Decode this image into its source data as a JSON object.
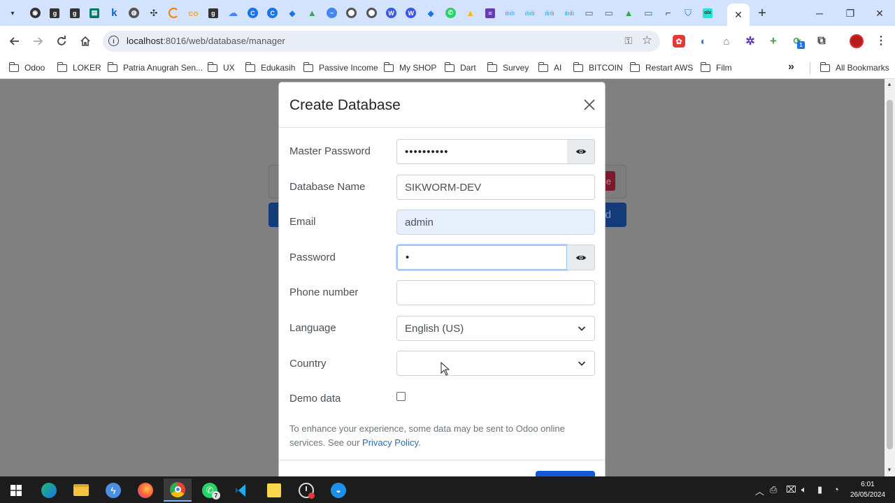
{
  "browser": {
    "url_host": "localhost",
    "url_rest": ":8016/web/database/manager",
    "active_tab_close": "✕",
    "new_tab": "+",
    "bookmarks": [
      {
        "label": "Odoo",
        "icon": "folder-icon"
      },
      {
        "label": "LOKER",
        "icon": "folder-icon"
      },
      {
        "label": "Patria Anugrah Sen...",
        "icon": "folder-icon"
      },
      {
        "label": "UX",
        "icon": "folder-icon"
      },
      {
        "label": "Edukasih",
        "icon": "folder-icon"
      },
      {
        "label": "Passive Income",
        "icon": "folder-icon"
      },
      {
        "label": "My SHOP",
        "icon": "folder-icon"
      },
      {
        "label": "Dart",
        "icon": "folder-icon"
      },
      {
        "label": "Survey",
        "icon": "folder-icon"
      },
      {
        "label": "AI",
        "icon": "folder-icon"
      },
      {
        "label": "BITCOIN",
        "icon": "folder-icon"
      },
      {
        "label": "Restart AWS",
        "icon": "folder-icon"
      },
      {
        "label": "Film",
        "icon": "folder-icon"
      }
    ],
    "all_bookmarks": "All Bookmarks",
    "extension_badge": "1",
    "colors": {
      "tabstrip": "#d3e3fd",
      "omnibox": "#e9eef6"
    }
  },
  "background_page": {
    "red_button_fragment": "e",
    "blue_button_fragment": "d"
  },
  "modal": {
    "title": "Create Database",
    "fields": {
      "master_password": {
        "label": "Master Password",
        "value": "••••••••••"
      },
      "database_name": {
        "label": "Database Name",
        "value": "SIKWORM-DEV"
      },
      "email": {
        "label": "Email",
        "value": "admin"
      },
      "password": {
        "label": "Password",
        "value": "•"
      },
      "phone": {
        "label": "Phone number",
        "value": ""
      },
      "language": {
        "label": "Language",
        "value": "English (US)"
      },
      "country": {
        "label": "Country",
        "value": ""
      },
      "demo_data": {
        "label": "Demo data",
        "checked": false
      }
    },
    "notice_text": "To enhance your experience, some data may be sent to Odoo online services. See our ",
    "privacy_link": "Privacy Policy",
    "notice_end": ".",
    "colors": {
      "primary": "#1558d6",
      "link": "#2f6bb3",
      "autofill": "#e8f0fe"
    }
  },
  "taskbar": {
    "whatsapp_badge": "7",
    "time": "6:01",
    "date": "26/05/2024"
  }
}
